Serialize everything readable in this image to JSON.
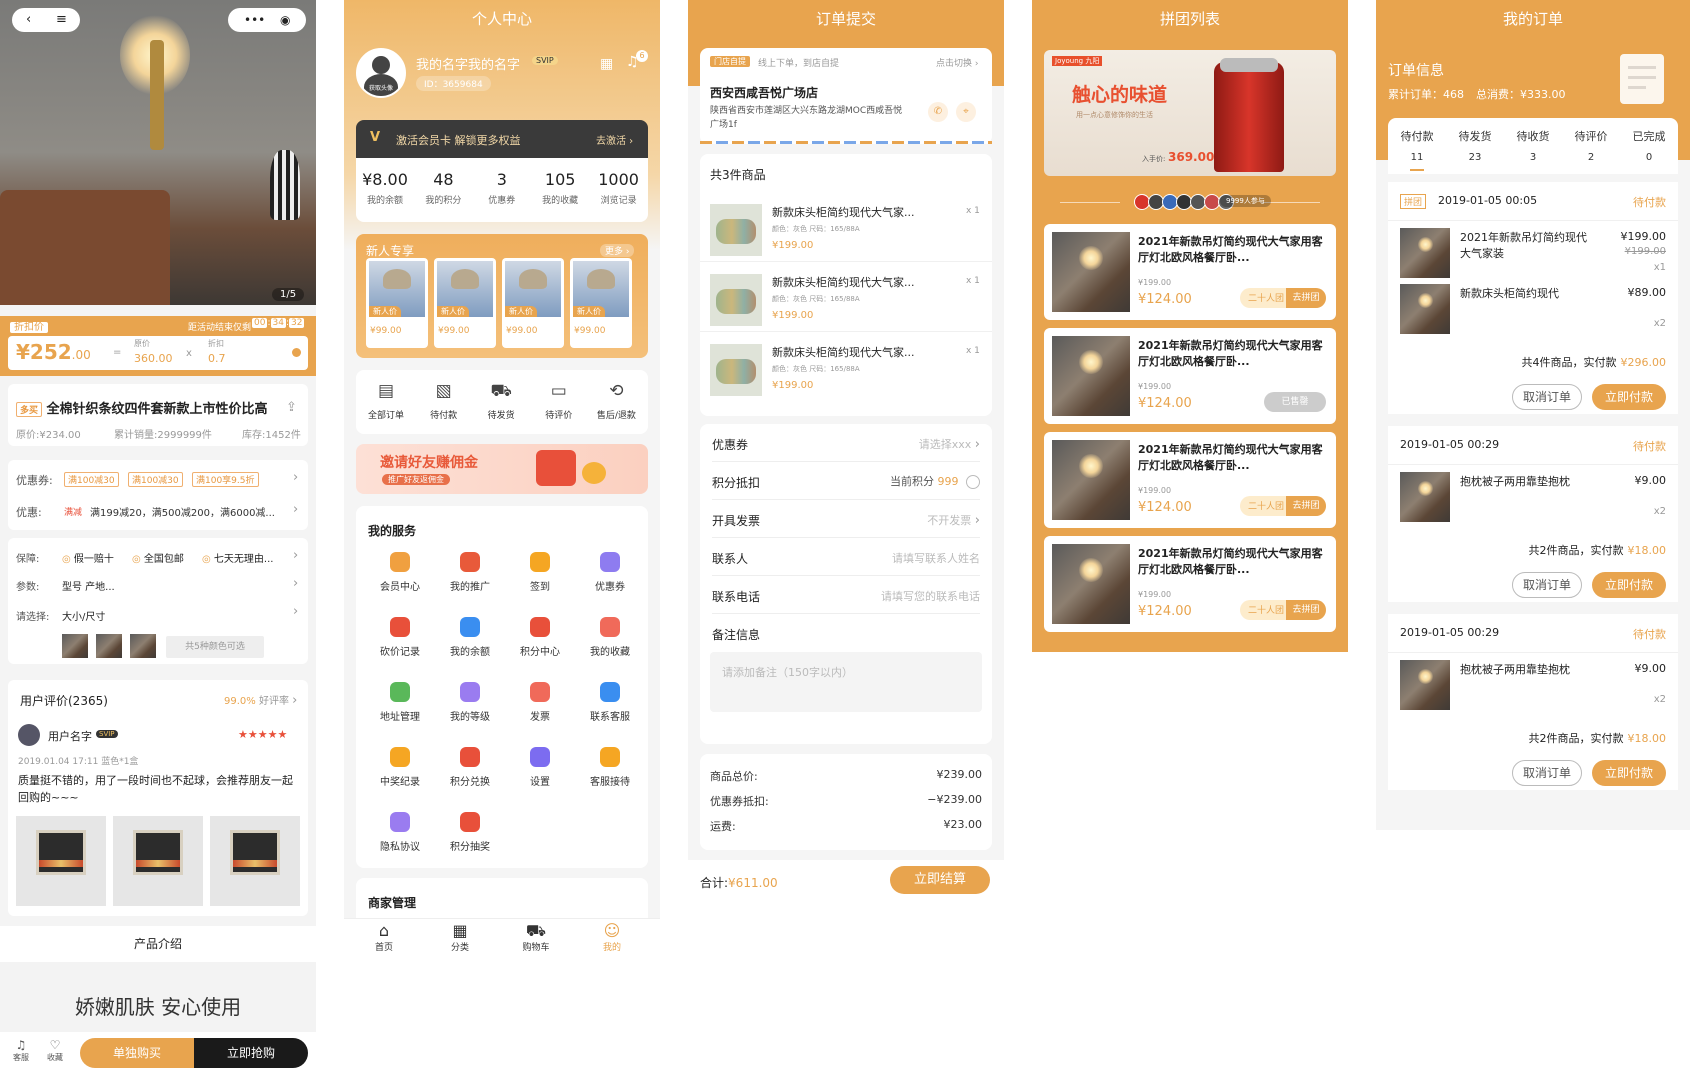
{
  "colors": {
    "accent": "#e8a44e",
    "dark": "#222222"
  },
  "s1": {
    "counter": "1/5",
    "discount_tag": "折扣价",
    "countdown_label": "距活动结束仅剩",
    "countdown": [
      "00",
      "34",
      "32"
    ],
    "price": "¥252",
    "price_dec": ".00",
    "eq": "=",
    "orig_label": "原价",
    "orig_value": "360.00",
    "times": "x",
    "disc_label": "折扣",
    "disc_value": "0.7",
    "prod_tag": "多买",
    "prod_title": "全棉针织条纹四件套新款上市性价比高",
    "orig_price": "原价:¥234.00",
    "sales": "累计销量:2999999件",
    "stock": "库存:1452件",
    "coupon_label": "优惠券:",
    "coupons": [
      "满100减30",
      "满100减30",
      "满100享9.5折"
    ],
    "promo_label": "优惠:",
    "promo_tag": "满减",
    "promo_text": "满199减20，满500减200，满6000减...",
    "guarantee_label": "保障:",
    "guarantees": [
      "假一赔十",
      "全国包邮",
      "七天无理由..."
    ],
    "param_label": "参数:",
    "param_value": "型号 产地...",
    "select_label": "请选择:",
    "select_value": "大小/尺寸",
    "colors_more": "共5种颜色可选",
    "review_title": "用户评价(2365)",
    "review_rate": "99.0%",
    "review_rate_label": "好评率",
    "user_name": "用户名字",
    "user_badge": "SVIP",
    "stars": "★★★★★",
    "review_meta": "2019.01.04 17:11 蓝色*1盒",
    "review_text": "质量挺不错的，用了一段时间也不起球，会推荐朋友一起回购的~~~",
    "intro_title": "产品介绍",
    "intro_big": "娇嫩肌肤 安心使用",
    "bar": {
      "service": "客服",
      "collect": "收藏",
      "buy_single": "单独购买",
      "buy_now": "立即抢购"
    }
  },
  "s2": {
    "title": "个人中心",
    "avatar_label": "获取头像",
    "name": "我的名字我的名字",
    "svip": "SVIP",
    "id": "ID：3659684",
    "msg_count": "6",
    "vip_text": "激活会员卡 解锁更多权益",
    "vip_btn": "去激活",
    "stats": [
      {
        "v": "¥8.00",
        "l": "我的余额"
      },
      {
        "v": "48",
        "l": "我的积分"
      },
      {
        "v": "3",
        "l": "优惠券"
      },
      {
        "v": "105",
        "l": "我的收藏"
      },
      {
        "v": "1000",
        "l": "浏览记录"
      }
    ],
    "new_title": "新人专享",
    "new_more": "更多",
    "new_items": [
      {
        "tag": "新人价",
        "p": "¥99.00"
      },
      {
        "tag": "新人价",
        "p": "¥99.00"
      },
      {
        "tag": "新人价",
        "p": "¥99.00"
      },
      {
        "tag": "新人价",
        "p": "¥99.00"
      }
    ],
    "orders": [
      {
        "l": "全部订单",
        "i": "▤"
      },
      {
        "l": "待付款",
        "i": "▧"
      },
      {
        "l": "待发货",
        "i": "⛟"
      },
      {
        "l": "待评价",
        "i": "▭"
      },
      {
        "l": "售后/退款",
        "i": "⟲"
      }
    ],
    "invite_title": "邀请好友赚佣金",
    "invite_sub": "推广好友返佣金",
    "svc_title": "我的服务",
    "services": [
      {
        "l": "会员中心",
        "c": "#f0a040"
      },
      {
        "l": "我的推广",
        "c": "#e85a3a"
      },
      {
        "l": "签到",
        "c": "#f5a623"
      },
      {
        "l": "优惠券",
        "c": "#8e7cf0"
      },
      {
        "l": "砍价记录",
        "c": "#e8503a"
      },
      {
        "l": "我的余额",
        "c": "#3a8ef0"
      },
      {
        "l": "积分中心",
        "c": "#e8503a"
      },
      {
        "l": "我的收藏",
        "c": "#f06a5a"
      },
      {
        "l": "地址管理",
        "c": "#5ab85a"
      },
      {
        "l": "我的等级",
        "c": "#9a7cf0"
      },
      {
        "l": "发票",
        "c": "#f06a5a"
      },
      {
        "l": "联系客服",
        "c": "#3a8ef0"
      },
      {
        "l": "中奖纪录",
        "c": "#f5a623"
      },
      {
        "l": "积分兑换",
        "c": "#e8503a"
      },
      {
        "l": "设置",
        "c": "#7c6cf0"
      },
      {
        "l": "客服接待",
        "c": "#f5a623"
      },
      {
        "l": "隐私协议",
        "c": "#9a7cf0"
      },
      {
        "l": "积分抽奖",
        "c": "#e8503a"
      }
    ],
    "merchant": "商家管理",
    "tabs": [
      {
        "l": "首页",
        "i": "⌂"
      },
      {
        "l": "分类",
        "i": "▦"
      },
      {
        "l": "购物车",
        "i": "⛟"
      },
      {
        "l": "我的",
        "i": "☺"
      }
    ]
  },
  "s3": {
    "title": "订单提交",
    "store_tag": "门店自提",
    "store_hint": "线上下单，到店自提",
    "switch": "点击切换",
    "store_name": "西安西咸吾悦广场店",
    "store_addr": "陕西省西安市莲湖区大兴东路龙湖MOC西咸吾悦广场1f",
    "goods_count": "共3件商品",
    "goods": [
      {
        "t": "新款床头柜简约现代大气家...",
        "s": "颜色：灰色  尺码：165/88A",
        "p": "¥199.00",
        "q": "x 1"
      },
      {
        "t": "新款床头柜简约现代大气家...",
        "s": "颜色：灰色  尺码：165/88A",
        "p": "¥199.00",
        "q": "x 1"
      },
      {
        "t": "新款床头柜简约现代大气家...",
        "s": "颜色：灰色  尺码：165/88A",
        "p": "¥199.00",
        "q": "x 1"
      }
    ],
    "coupon_label": "优惠券",
    "coupon_ph": "请选择xxx",
    "points_label": "积分抵扣",
    "points_text": "当前积分",
    "points_val": "999",
    "invoice_label": "开具发票",
    "invoice_val": "不开发票",
    "contact_label": "联系人",
    "contact_ph": "请填写联系人姓名",
    "phone_label": "联系电话",
    "phone_ph": "请填写您的联系电话",
    "remark_label": "备注信息",
    "remark_ph": "请添加备注（150字以内）",
    "sum": [
      {
        "l": "商品总价:",
        "v": "¥239.00"
      },
      {
        "l": "优惠券抵扣:",
        "v": "−¥239.00"
      },
      {
        "l": "运费:",
        "v": "¥23.00"
      }
    ],
    "total_label": "合计:",
    "total": "¥611.00",
    "submit": "立即结算"
  },
  "s4": {
    "title": "拼团列表",
    "banner_brand": "Joyoung 九阳",
    "banner_title": "触心的味道",
    "banner_sub": "用一点心意修饰你的生活",
    "banner_price_label": "入手价:",
    "banner_price": "369.00",
    "joined": "9999人参与",
    "items": [
      {
        "t": "2021年新款吊灯简约现代大气家用客厅灯北欧风格餐厅卧...",
        "o": "¥199.00",
        "p": "¥124.00",
        "g": "二十人团",
        "b": "去拼团",
        "sold": false
      },
      {
        "t": "2021年新款吊灯简约现代大气家用客厅灯北欧风格餐厅卧...",
        "o": "¥199.00",
        "p": "¥124.00",
        "g": "",
        "b": "已售罄",
        "sold": true
      },
      {
        "t": "2021年新款吊灯简约现代大气家用客厅灯北欧风格餐厅卧...",
        "o": "¥199.00",
        "p": "¥124.00",
        "g": "二十人团",
        "b": "去拼团",
        "sold": false
      },
      {
        "t": "2021年新款吊灯简约现代大气家用客厅灯北欧风格餐厅卧...",
        "o": "¥199.00",
        "p": "¥124.00",
        "g": "二十人团",
        "b": "去拼团",
        "sold": false
      }
    ]
  },
  "s5": {
    "title": "我的订单",
    "info_title": "订单信息",
    "info_orders": "累计订单：468",
    "info_spent": "总消费：¥333.00",
    "tabs": [
      {
        "l": "待付款",
        "n": "11"
      },
      {
        "l": "待发货",
        "n": "23"
      },
      {
        "l": "待收货",
        "n": "3"
      },
      {
        "l": "待评价",
        "n": "2"
      },
      {
        "l": "已完成",
        "n": "0"
      }
    ],
    "orders": [
      {
        "tag": "拼团",
        "time": "2019-01-05 00:05",
        "status": "待付款",
        "items": [
          {
            "t": "2021年新款吊灯简约现代大气家装",
            "p": "¥199.00",
            "op": "¥199.00",
            "q": "x1"
          },
          {
            "t": "新款床头柜简约现代",
            "p": "¥89.00",
            "op": "",
            "q": "x2"
          }
        ],
        "sum": "共4件商品，实付款",
        "total": "¥296.00",
        "cancel": "取消订单",
        "pay": "立即付款"
      },
      {
        "tag": "",
        "time": "2019-01-05 00:29",
        "status": "待付款",
        "items": [
          {
            "t": "抱枕被子两用靠垫抱枕",
            "p": "¥9.00",
            "op": "",
            "q": "x2"
          }
        ],
        "sum": "共2件商品，实付款",
        "total": "¥18.00",
        "cancel": "取消订单",
        "pay": "立即付款"
      },
      {
        "tag": "",
        "time": "2019-01-05 00:29",
        "status": "待付款",
        "items": [
          {
            "t": "抱枕被子两用靠垫抱枕",
            "p": "¥9.00",
            "op": "",
            "q": "x2"
          }
        ],
        "sum": "共2件商品，实付款",
        "total": "¥18.00",
        "cancel": "取消订单",
        "pay": "立即付款"
      }
    ]
  }
}
